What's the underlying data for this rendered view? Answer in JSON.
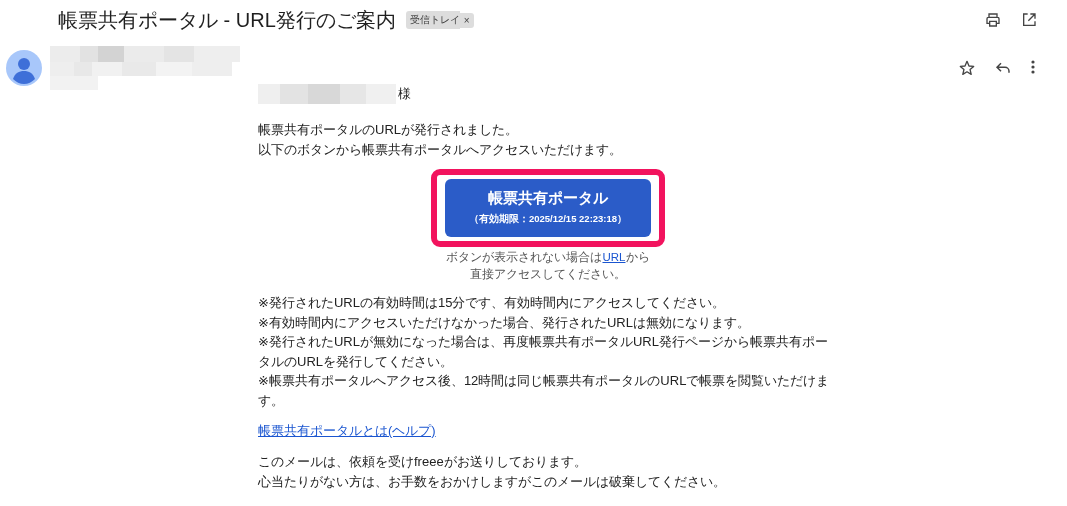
{
  "subject": "帳票共有ポータル - URL発行のご案内",
  "label": {
    "text": "受信トレイ",
    "remove": "×"
  },
  "greeting_suffix": "様",
  "intro": [
    "帳票共有ポータルのURLが発行されました。",
    "以下のボタンから帳票共有ポータルへアクセスいただけます。"
  ],
  "portal_button": {
    "title": "帳票共有ポータル",
    "expiry": "（有効期限：2025/12/15 22:23:18）",
    "highlighted": true
  },
  "fallback": {
    "before": "ボタンが表示されない場合は",
    "link": "URL",
    "after": "から",
    "line2": "直接アクセスしてください。"
  },
  "notes": [
    "※発行されたURLの有効時間は15分です、有効時間内にアクセスしてください。",
    "※有効時間内にアクセスいただけなかった場合、発行されたURLは無効になります。",
    "※発行されたURLが無効になった場合は、再度帳票共有ポータルURL発行ページから帳票共有ポータルのURLを発行してください。",
    "※帳票共有ポータルへアクセス後、12時間は同じ帳票共有ポータルのURLで帳票を閲覧いただけます。"
  ],
  "help_link": "帳票共有ポータルとは(ヘルプ)",
  "footer": [
    "このメールは、依頼を受けfreeeがお送りしております。",
    "心当たりがない方は、お手数をおかけしますがこのメールは破棄してください。"
  ]
}
